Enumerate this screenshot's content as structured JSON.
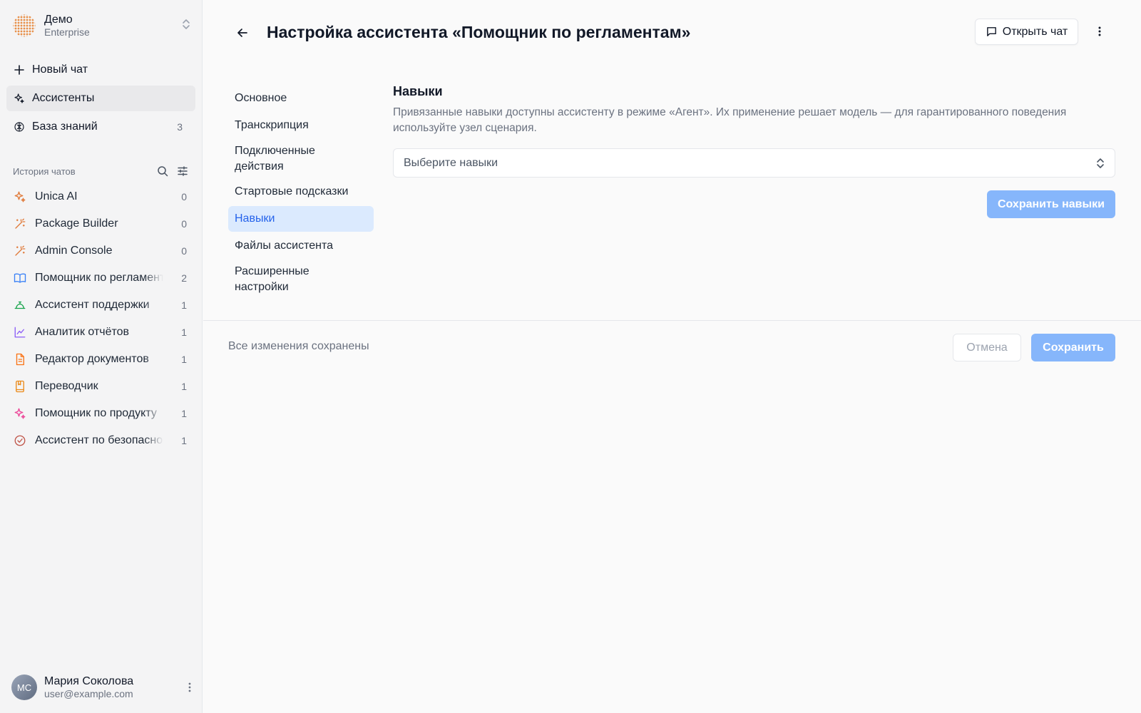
{
  "workspace": {
    "name": "Демо",
    "plan": "Enterprise"
  },
  "nav": {
    "new_chat": "Новый чат",
    "assistants": "Ассистенты",
    "knowledge": "База знаний",
    "knowledge_count": "3"
  },
  "history": {
    "title": "История чатов",
    "chats": [
      {
        "label": "Unica AI",
        "count": "0",
        "icon": "sparkle-icon",
        "color": "#e07a3a"
      },
      {
        "label": "Package Builder",
        "count": "0",
        "icon": "wand-icon",
        "color": "#e07a3a"
      },
      {
        "label": "Admin Console",
        "count": "0",
        "icon": "wand-icon",
        "color": "#e07a3a"
      },
      {
        "label": "Помощник по регламентам",
        "count": "2",
        "icon": "book-icon",
        "color": "#3b82f6"
      },
      {
        "label": "Ассистент поддержки",
        "count": "1",
        "icon": "bell-icon",
        "color": "#16a34a"
      },
      {
        "label": "Аналитик отчётов",
        "count": "1",
        "icon": "chart-line-icon",
        "color": "#8b5cf6"
      },
      {
        "label": "Редактор документов",
        "count": "1",
        "icon": "file-icon",
        "color": "#f97316"
      },
      {
        "label": "Переводчик",
        "count": "1",
        "icon": "book-bookmark-icon",
        "color": "#ea8a1a"
      },
      {
        "label": "Помощник по продукту",
        "count": "1",
        "icon": "sparkle-icon",
        "color": "#ec4899"
      },
      {
        "label": "Ассистент по безопасности",
        "count": "1",
        "icon": "check-circle-icon",
        "color": "#c0564a"
      }
    ]
  },
  "user": {
    "name": "Мария Соколова",
    "email": "user@example.com",
    "initials": "МС"
  },
  "header": {
    "title": "Настройка ассистента «Помощник по регламентам»",
    "open_chat": "Открыть чат"
  },
  "settings_nav": [
    {
      "label": "Основное"
    },
    {
      "label": "Транскрипция"
    },
    {
      "label": "Подключенные действия"
    },
    {
      "label": "Стартовые подсказки"
    },
    {
      "label": "Навыки",
      "active": true
    },
    {
      "label": "Файлы ассистента"
    },
    {
      "label": "Расширенные настройки"
    }
  ],
  "skills": {
    "title": "Навыки",
    "description": "Привязанные навыки доступны ассистенту в режиме «Агент». Их применение решает модель — для гарантированного поведения используйте узел сценария.",
    "select_placeholder": "Выберите навыки",
    "save_button": "Сохранить навыки"
  },
  "footer": {
    "status": "Все изменения сохранены",
    "cancel": "Отмена",
    "save": "Сохранить"
  },
  "colors": {
    "primary_disabled": "#86b6fb",
    "active_nav_bg": "#dbeafe",
    "active_nav_text": "#2563eb"
  }
}
